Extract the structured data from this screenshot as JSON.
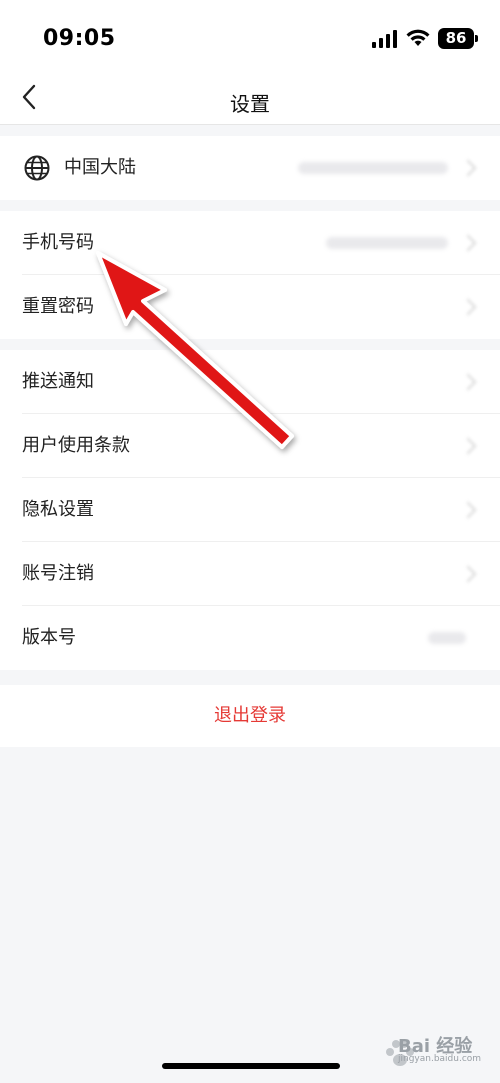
{
  "status_bar": {
    "time": "09:05",
    "battery": "86"
  },
  "nav": {
    "title": "设置"
  },
  "region": {
    "label": "中国大陆"
  },
  "account": {
    "phone_label": "手机号码",
    "reset_password_label": "重置密码"
  },
  "settings": {
    "items": [
      {
        "label": "推送通知"
      },
      {
        "label": "用户使用条款"
      },
      {
        "label": "隐私设置"
      },
      {
        "label": "账号注销"
      },
      {
        "label": "版本号"
      }
    ]
  },
  "logout": {
    "label": "退出登录"
  },
  "watermark": {
    "text": "Bai 经验",
    "sub": "jingyan.baidu.com"
  },
  "colors": {
    "logout": "#e53935",
    "arrow": "#e01414",
    "background": "#f5f6f8"
  },
  "icons": {
    "back": "chevron-left-icon",
    "region": "globe-icon",
    "arrow": "red-arrow-annotation"
  }
}
